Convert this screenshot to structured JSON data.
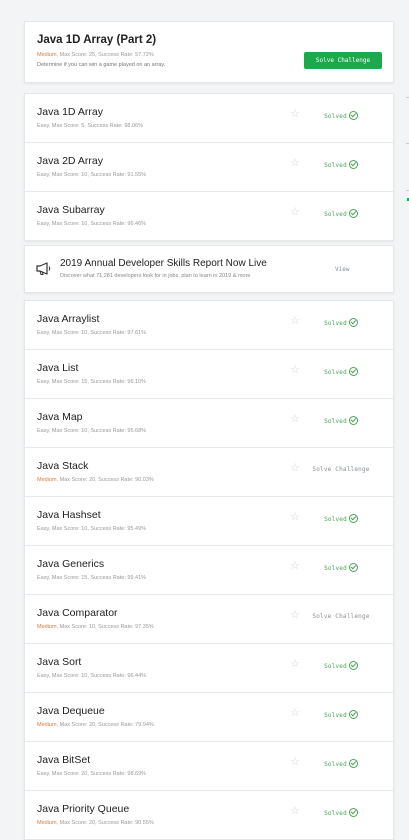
{
  "featured": {
    "title": "Java 1D Array (Part 2)",
    "difficulty": "Medium",
    "meta_rest": ", Max Score: 25, Success Rate: 57.72%",
    "description": "Determine if you can win a game played on an array.",
    "button_label": "Solve Challenge"
  },
  "group1": [
    {
      "title": "Java 1D Array",
      "difficulty": "Easy",
      "meta_rest": ", Max Score: 5, Success Rate: 98.06%",
      "status": "Solved"
    },
    {
      "title": "Java 2D Array",
      "difficulty": "Easy",
      "meta_rest": ", Max Score: 10, Success Rate: 91.55%",
      "status": "Solved"
    },
    {
      "title": "Java Subarray",
      "difficulty": "Easy",
      "meta_rest": ", Max Score: 10, Success Rate: 96.46%",
      "status": "Solved"
    }
  ],
  "promo": {
    "title": "2019 Annual Developer Skills Report Now Live",
    "description": "Discover what 71,281 developers look for in jobs, plan to learn in 2019 & more",
    "link": "View"
  },
  "group2": [
    {
      "title": "Java Arraylist",
      "difficulty": "Easy",
      "meta_rest": ", Max Score: 10, Success Rate: 97.61%",
      "status": "Solved"
    },
    {
      "title": "Java List",
      "difficulty": "Easy",
      "meta_rest": ", Max Score: 15, Success Rate: 96.10%",
      "status": "Solved"
    },
    {
      "title": "Java Map",
      "difficulty": "Easy",
      "meta_rest": ", Max Score: 10, Success Rate: 95.68%",
      "status": "Solved"
    },
    {
      "title": "Java Stack",
      "difficulty": "Medium",
      "meta_rest": ", Max Score: 20, Success Rate: 90.03%",
      "status": "Solve Challenge"
    },
    {
      "title": "Java Hashset",
      "difficulty": "Easy",
      "meta_rest": ", Max Score: 10, Success Rate: 95.49%",
      "status": "Solved"
    },
    {
      "title": "Java Generics",
      "difficulty": "Easy",
      "meta_rest": ", Max Score: 15, Success Rate: 99.41%",
      "status": "Solved"
    },
    {
      "title": "Java Comparator",
      "difficulty": "Medium",
      "meta_rest": ", Max Score: 10, Success Rate: 97.35%",
      "status": "Solve Challenge"
    },
    {
      "title": "Java Sort",
      "difficulty": "Easy",
      "meta_rest": ", Max Score: 10, Success Rate: 96.44%",
      "status": "Solved"
    },
    {
      "title": "Java Dequeue",
      "difficulty": "Medium",
      "meta_rest": ", Max Score: 20, Success Rate: 79.94%",
      "status": "Solved"
    },
    {
      "title": "Java BitSet",
      "difficulty": "Easy",
      "meta_rest": ", Max Score: 20, Success Rate: 98.69%",
      "status": "Solved"
    },
    {
      "title": "Java Priority Queue",
      "difficulty": "Medium",
      "meta_rest": ", Max Score: 20, Success Rate: 90.55%",
      "status": "Solved"
    }
  ],
  "colors": {
    "medium": "#e07a3c",
    "solved": "#4aa356",
    "button": "#1ba94c"
  }
}
